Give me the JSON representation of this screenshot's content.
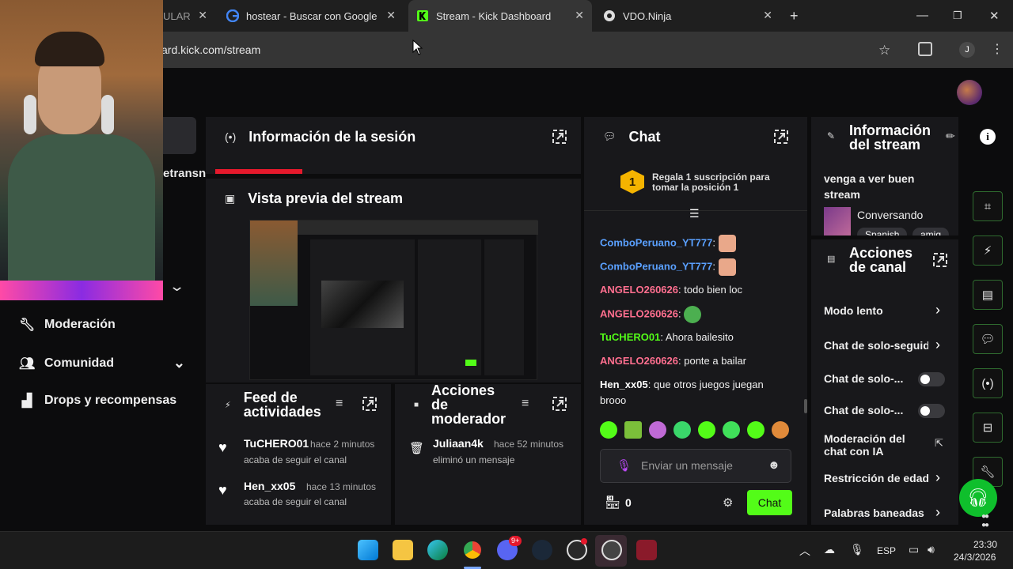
{
  "browser": {
    "tabs": [
      {
        "title": "ULAR",
        "icon": "generic-favicon"
      },
      {
        "title": "hostear - Buscar con Google",
        "icon": "google-icon"
      },
      {
        "title": "Stream - Kick Dashboard",
        "icon": "kick-icon"
      },
      {
        "title": "VDO.Ninja",
        "icon": "vdo-ninja-icon"
      }
    ],
    "url": "ard.kick.com/stream",
    "profile_initial": "J"
  },
  "sidebar": {
    "partial_label": "etransn",
    "items": [
      {
        "label": "Moderación",
        "icon": "wrench-icon"
      },
      {
        "label": "Comunidad",
        "icon": "users-icon"
      },
      {
        "label": "Drops y recompensas",
        "icon": "drops-icon"
      }
    ]
  },
  "session_panel": {
    "title": "Información de la sesión"
  },
  "preview_panel": {
    "title": "Vista previa del stream"
  },
  "activity_feed": {
    "title": "Feed de actividades",
    "items": [
      {
        "user": "TuCHERO01",
        "time": "hace 2 minutos",
        "action": "acaba de seguir el canal"
      },
      {
        "user": "Hen_xx05",
        "time": "hace 13 minutos",
        "action": "acaba de seguir el canal"
      }
    ]
  },
  "mod_actions": {
    "title": "Acciones de moderador",
    "items": [
      {
        "user": "Juliaan4k",
        "time": "hace 52 minutos",
        "action": "eliminó un mensaje"
      }
    ]
  },
  "chat": {
    "title": "Chat",
    "sub_badge": "1",
    "sub_text": "Regala 1 suscripción para tomar la posición 1",
    "messages": [
      {
        "user": "ComboPeruano_YT777",
        "text": "",
        "color": "#5aa0ff"
      },
      {
        "user": "ComboPeruano_YT777",
        "text": "",
        "color": "#5aa0ff"
      },
      {
        "user": "ANGELO260626",
        "text": "todo bien loc",
        "color": "#ff6f8f"
      },
      {
        "user": "ANGELO260626",
        "text": "",
        "color": "#ff6f8f"
      },
      {
        "user": "TuCHERO01",
        "text": "Ahora bailesito",
        "color": "#53fc18"
      },
      {
        "user": "ANGELO260626",
        "text": "ponte a bailar",
        "color": "#ff6f8f"
      },
      {
        "user": "Hen_xx05",
        "text": "que otros juegos juegan brooo",
        "color": "#ffffff"
      }
    ],
    "input_placeholder": "Enviar un mensaje",
    "points": "0",
    "send_label": "Chat"
  },
  "stream_info": {
    "title": "Información del stream",
    "stream_title": "venga a ver buen stream",
    "category": "Conversando",
    "tags": [
      "Spanish",
      "amig"
    ]
  },
  "channel_actions": {
    "title": "Acciones de canal",
    "options": [
      {
        "label": "Modo lento",
        "control": "chevron"
      },
      {
        "label": "Chat de solo-seguidores",
        "control": "chevron"
      },
      {
        "label": "Chat de solo-...",
        "control": "toggle"
      },
      {
        "label": "Chat de solo-...",
        "control": "toggle"
      },
      {
        "label": "Moderación del chat con IA",
        "control": "external"
      },
      {
        "label": "Restricción de edad",
        "control": "chevron"
      },
      {
        "label": "Palabras baneadas",
        "control": "chevron"
      }
    ]
  },
  "taskbar": {
    "time": "23:30",
    "date": "24/3/2026",
    "lang": "ESP",
    "discord_badge": "9+"
  },
  "colors": {
    "accent": "#53fc18",
    "panel": "#18181b",
    "background": "#0c0c0d"
  }
}
